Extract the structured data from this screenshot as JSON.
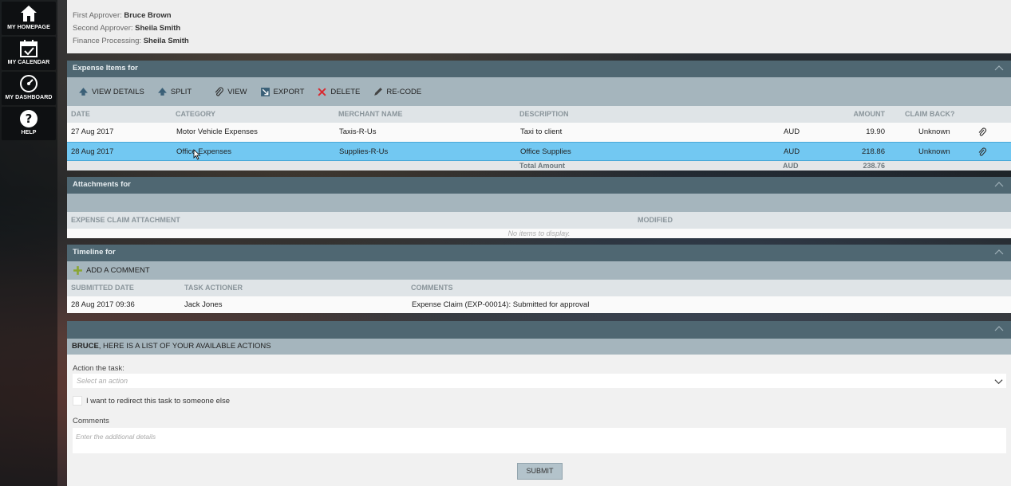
{
  "sidebar": {
    "items": [
      {
        "label": "MY HOMEPAGE"
      },
      {
        "label": "MY CALENDAR"
      },
      {
        "label": "MY DASHBOARD"
      },
      {
        "label": "HELP"
      }
    ]
  },
  "approvers": {
    "first_label": "First Approver:",
    "first_value": "Bruce Brown",
    "second_label": "Second Approver:",
    "second_value": "Sheila Smith",
    "finance_label": "Finance Processing:",
    "finance_value": "Sheila Smith"
  },
  "expense_items": {
    "title": "Expense Items for",
    "toolbar": {
      "view_details": "VIEW DETAILS",
      "split": "SPLIT",
      "view": "VIEW",
      "export": "EXPORT",
      "delete": "DELETE",
      "recode": "RE-CODE"
    },
    "columns": {
      "date": "DATE",
      "category": "CATEGORY",
      "merchant": "MERCHANT NAME",
      "description": "DESCRIPTION",
      "amount": "AMOUNT",
      "claim_back": "CLAIM BACK?"
    },
    "rows": [
      {
        "date": "27 Aug 2017",
        "category": "Motor Vehicle Expenses",
        "merchant": "Taxis-R-Us",
        "description": "Taxi to client",
        "currency": "AUD",
        "amount": "19.90",
        "claim_back": "Unknown"
      },
      {
        "date": "28 Aug 2017",
        "category": "Office Expenses",
        "merchant": "Supplies-R-Us",
        "description": "Office Supplies",
        "currency": "AUD",
        "amount": "218.86",
        "claim_back": "Unknown"
      }
    ],
    "total": {
      "label": "Total Amount",
      "currency": "AUD",
      "amount": "238.76"
    }
  },
  "attachments": {
    "title": "Attachments for",
    "columns": {
      "attachment": "EXPENSE CLAIM ATTACHMENT",
      "modified": "MODIFIED"
    },
    "empty_text": "No items to display."
  },
  "timeline": {
    "title": "Timeline for",
    "add_comment": "ADD A COMMENT",
    "columns": {
      "submitted_date": "SUBMITTED DATE",
      "actioner": "TASK ACTIONER",
      "comments": "COMMENTS"
    },
    "rows": [
      {
        "submitted_date": "28 Aug 2017 09:36",
        "actioner": "Jack Jones",
        "comments": "Expense Claim (EXP-00014): Submitted for approval"
      }
    ]
  },
  "actions": {
    "title_name": "BRUCE",
    "title_rest": ", HERE IS A LIST OF YOUR AVAILABLE ACTIONS",
    "action_label": "Action the task:",
    "action_placeholder": "Select an action",
    "redirect_label": "I want to redirect this task to someone else",
    "comments_label": "Comments",
    "comments_placeholder": "Enter the additional details",
    "submit": "SUBMIT"
  }
}
